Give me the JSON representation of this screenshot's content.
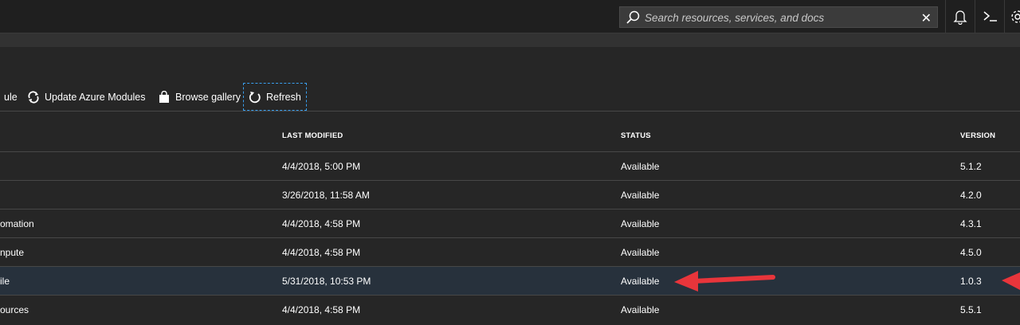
{
  "search": {
    "placeholder": "Search resources, services, and docs",
    "clear_icon": "close-icon"
  },
  "topbar": {
    "icons": [
      "notifications-bell-icon",
      "cloud-shell-icon",
      "settings-gear-icon"
    ]
  },
  "toolbar": {
    "items": [
      {
        "label": "ule",
        "icon": "",
        "focused": false
      },
      {
        "label": "Update Azure Modules",
        "icon": "sync-icon",
        "focused": false
      },
      {
        "label": "Browse gallery",
        "icon": "shopping-bag-icon",
        "focused": false
      },
      {
        "label": "Refresh",
        "icon": "refresh-icon",
        "focused": true
      }
    ]
  },
  "table": {
    "headers": {
      "last_modified": "LAST MODIFIED",
      "status": "STATUS",
      "version": "VERSION"
    },
    "rows": [
      {
        "name": "",
        "last_modified": "4/4/2018, 5:00 PM",
        "status": "Available",
        "version": "5.1.2",
        "selected": false
      },
      {
        "name": "",
        "last_modified": "3/26/2018, 11:58 AM",
        "status": "Available",
        "version": "4.2.0",
        "selected": false
      },
      {
        "name": "omation",
        "last_modified": "4/4/2018, 4:58 PM",
        "status": "Available",
        "version": "4.3.1",
        "selected": false
      },
      {
        "name": "npute",
        "last_modified": "4/4/2018, 4:58 PM",
        "status": "Available",
        "version": "4.5.0",
        "selected": false
      },
      {
        "name": "ile",
        "last_modified": "5/31/2018, 10:53 PM",
        "status": "Available",
        "version": "1.0.3",
        "selected": true
      },
      {
        "name": "ources",
        "last_modified": "4/4/2018, 4:58 PM",
        "status": "Available",
        "version": "5.5.1",
        "selected": false
      }
    ]
  },
  "annotation_color": "#e8353b"
}
